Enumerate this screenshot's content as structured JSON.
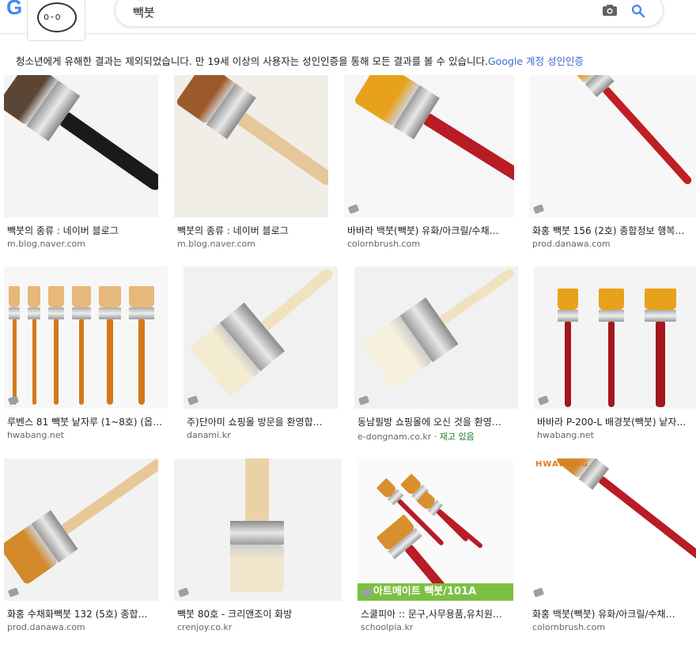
{
  "search": {
    "query": "빽붓",
    "logo": "G"
  },
  "notice": {
    "text": "청소년에게 유해한 결과는 제외되었습니다. 만 19세 이상의 사용자는 성인인증을 통해 모든 결과를 볼 수 있습니다.",
    "link": "Google 계정 성인인증"
  },
  "results": [
    {
      "caption": "빽붓의 종류 : 네이버 블로그",
      "source": "m.blog.naver.com"
    },
    {
      "caption": "빽붓의 종류 : 네이버 블로그",
      "source": "m.blog.naver.com"
    },
    {
      "caption": "바바라 백붓(빽붓) 유화/아크릴/수채…",
      "source": "colornbrush.com"
    },
    {
      "caption": "화홍 빽붓 156 (2호) 종합정보 행복…",
      "source": "prod.danawa.com"
    },
    {
      "caption": "루벤스 81 빽붓 낱자루 (1~8호) (옵…",
      "source": "hwabang.net"
    },
    {
      "caption": "주)단아미 쇼핑몰 방문을 환영합…",
      "source": "danami.kr"
    },
    {
      "caption": "동남필방 쇼핑몰에 오신 것을 환영…",
      "source": "e-dongnam.co.kr",
      "stock": " · 재고 있음"
    },
    {
      "caption": "바바라 P-200-L 배경붓(빽붓) 낱자…",
      "source": "hwabang.net"
    },
    {
      "caption": "화홍 수채화빽붓 132 (5호) 종합…",
      "source": "prod.danawa.com"
    },
    {
      "caption": "빽붓 80호 - 크리앤조이 화방",
      "source": "crenjoy.co.kr"
    },
    {
      "caption": "스쿨피아 :: 문구,사무용품,유치원…",
      "source": "schoolpia.kr"
    },
    {
      "caption": "화홍 백붓(빽붓) 유화/아크릴/수채…",
      "source": "colornbrush.com"
    }
  ],
  "overlays": {
    "schoolpia_banner": "아트메이트 빽붓/101A",
    "hwahong_logo": "HWAHONG"
  }
}
